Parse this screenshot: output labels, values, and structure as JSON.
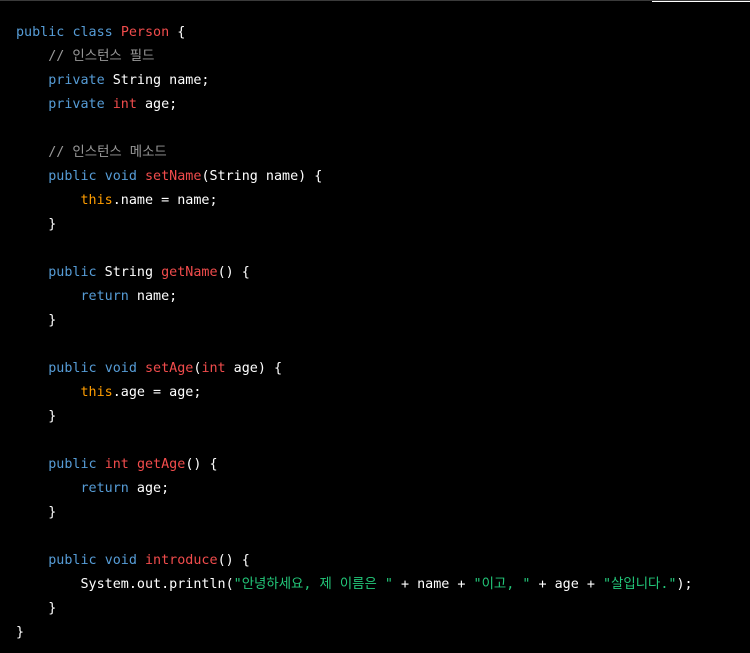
{
  "code": {
    "lines": [
      [
        {
          "t": "kw",
          "s": "public"
        },
        {
          "t": "plain",
          "s": " "
        },
        {
          "t": "kw",
          "s": "class"
        },
        {
          "t": "plain",
          "s": " "
        },
        {
          "t": "fn",
          "s": "Person"
        },
        {
          "t": "plain",
          "s": " {"
        }
      ],
      [
        {
          "t": "plain",
          "s": "    "
        },
        {
          "t": "cm",
          "s": "// 인스턴스 필드"
        }
      ],
      [
        {
          "t": "plain",
          "s": "    "
        },
        {
          "t": "kw",
          "s": "private"
        },
        {
          "t": "plain",
          "s": " String name;"
        }
      ],
      [
        {
          "t": "plain",
          "s": "    "
        },
        {
          "t": "kw",
          "s": "private"
        },
        {
          "t": "plain",
          "s": " "
        },
        {
          "t": "prim",
          "s": "int"
        },
        {
          "t": "plain",
          "s": " age;"
        }
      ],
      [
        {
          "t": "plain",
          "s": ""
        }
      ],
      [
        {
          "t": "plain",
          "s": "    "
        },
        {
          "t": "cm",
          "s": "// 인스턴스 메소드"
        }
      ],
      [
        {
          "t": "plain",
          "s": "    "
        },
        {
          "t": "kw",
          "s": "public"
        },
        {
          "t": "plain",
          "s": " "
        },
        {
          "t": "kw",
          "s": "void"
        },
        {
          "t": "plain",
          "s": " "
        },
        {
          "t": "fn",
          "s": "setName"
        },
        {
          "t": "plain",
          "s": "(String name) {"
        }
      ],
      [
        {
          "t": "plain",
          "s": "        "
        },
        {
          "t": "this",
          "s": "this"
        },
        {
          "t": "plain",
          "s": ".name = name;"
        }
      ],
      [
        {
          "t": "plain",
          "s": "    }"
        }
      ],
      [
        {
          "t": "plain",
          "s": ""
        }
      ],
      [
        {
          "t": "plain",
          "s": "    "
        },
        {
          "t": "kw",
          "s": "public"
        },
        {
          "t": "plain",
          "s": " String "
        },
        {
          "t": "fn",
          "s": "getName"
        },
        {
          "t": "plain",
          "s": "() {"
        }
      ],
      [
        {
          "t": "plain",
          "s": "        "
        },
        {
          "t": "ret",
          "s": "return"
        },
        {
          "t": "plain",
          "s": " name;"
        }
      ],
      [
        {
          "t": "plain",
          "s": "    }"
        }
      ],
      [
        {
          "t": "plain",
          "s": ""
        }
      ],
      [
        {
          "t": "plain",
          "s": "    "
        },
        {
          "t": "kw",
          "s": "public"
        },
        {
          "t": "plain",
          "s": " "
        },
        {
          "t": "kw",
          "s": "void"
        },
        {
          "t": "plain",
          "s": " "
        },
        {
          "t": "fn",
          "s": "setAge"
        },
        {
          "t": "plain",
          "s": "("
        },
        {
          "t": "prim",
          "s": "int"
        },
        {
          "t": "plain",
          "s": " age) {"
        }
      ],
      [
        {
          "t": "plain",
          "s": "        "
        },
        {
          "t": "this",
          "s": "this"
        },
        {
          "t": "plain",
          "s": ".age = age;"
        }
      ],
      [
        {
          "t": "plain",
          "s": "    }"
        }
      ],
      [
        {
          "t": "plain",
          "s": ""
        }
      ],
      [
        {
          "t": "plain",
          "s": "    "
        },
        {
          "t": "kw",
          "s": "public"
        },
        {
          "t": "plain",
          "s": " "
        },
        {
          "t": "prim",
          "s": "int"
        },
        {
          "t": "plain",
          "s": " "
        },
        {
          "t": "fn",
          "s": "getAge"
        },
        {
          "t": "plain",
          "s": "() {"
        }
      ],
      [
        {
          "t": "plain",
          "s": "        "
        },
        {
          "t": "ret",
          "s": "return"
        },
        {
          "t": "plain",
          "s": " age;"
        }
      ],
      [
        {
          "t": "plain",
          "s": "    }"
        }
      ],
      [
        {
          "t": "plain",
          "s": ""
        }
      ],
      [
        {
          "t": "plain",
          "s": "    "
        },
        {
          "t": "kw",
          "s": "public"
        },
        {
          "t": "plain",
          "s": " "
        },
        {
          "t": "kw",
          "s": "void"
        },
        {
          "t": "plain",
          "s": " "
        },
        {
          "t": "fn",
          "s": "introduce"
        },
        {
          "t": "plain",
          "s": "() {"
        }
      ],
      [
        {
          "t": "plain",
          "s": "        System.out.println("
        },
        {
          "t": "str",
          "s": "\"안녕하세요, 제 이름은 \""
        },
        {
          "t": "plain",
          "s": " + name + "
        },
        {
          "t": "str",
          "s": "\"이고, \""
        },
        {
          "t": "plain",
          "s": " + age + "
        },
        {
          "t": "str",
          "s": "\"살입니다.\""
        },
        {
          "t": "plain",
          "s": ");"
        }
      ],
      [
        {
          "t": "plain",
          "s": "    }"
        }
      ],
      [
        {
          "t": "plain",
          "s": "}"
        }
      ]
    ]
  },
  "colors": {
    "background": "#000000",
    "keyword": "#569cd6",
    "function_name": "#f14c4c",
    "this_keyword": "#ff9d00",
    "comment": "#9a9a9a",
    "string": "#23c87a",
    "text": "#ffffff"
  }
}
